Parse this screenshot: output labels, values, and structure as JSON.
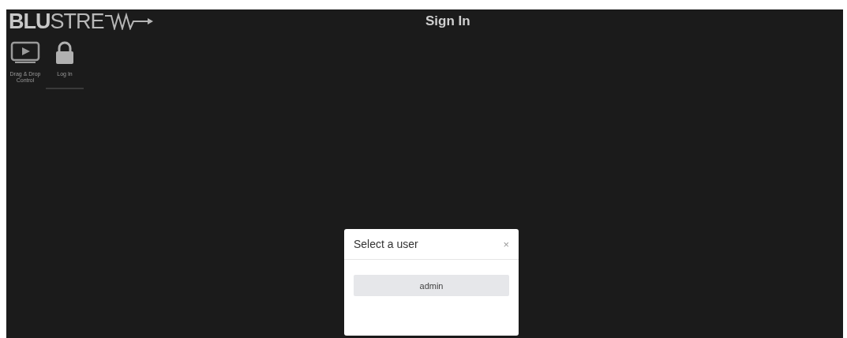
{
  "header": {
    "logo": "**BLU**STRE",
    "title": "Sign In"
  },
  "nav": [
    {
      "label": "Drag & Drop Control",
      "kind": "play",
      "selected": false
    },
    {
      "label": "Log In",
      "kind": "lock",
      "selected": true
    }
  ],
  "dialog": {
    "title": "Select a user",
    "close": "×",
    "users": [
      "admin"
    ]
  }
}
